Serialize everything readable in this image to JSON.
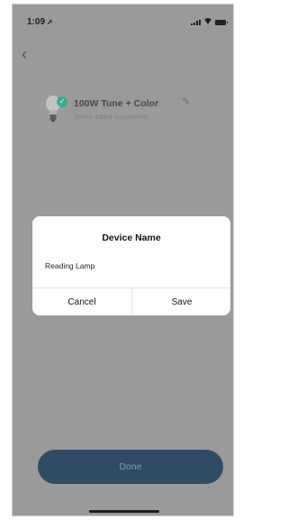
{
  "status_bar": {
    "time": "1:09",
    "location_icon": "location-arrow-icon",
    "icons": [
      "cellular-signal-icon",
      "wifi-icon",
      "battery-icon"
    ]
  },
  "nav": {
    "back_icon": "chevron-left-icon"
  },
  "device": {
    "name": "100W Tune + Color",
    "status": "Device added successfully",
    "icon": "light-bulb-icon",
    "badge_icon": "checkmark-icon",
    "edit_icon": "pencil-icon",
    "badge_color": "#2fae8d"
  },
  "dialog": {
    "title": "Device Name",
    "input_value": "Reading Lamp",
    "cancel_label": "Cancel",
    "save_label": "Save"
  },
  "footer": {
    "done_label": "Done",
    "done_color": "#2f4c66"
  }
}
